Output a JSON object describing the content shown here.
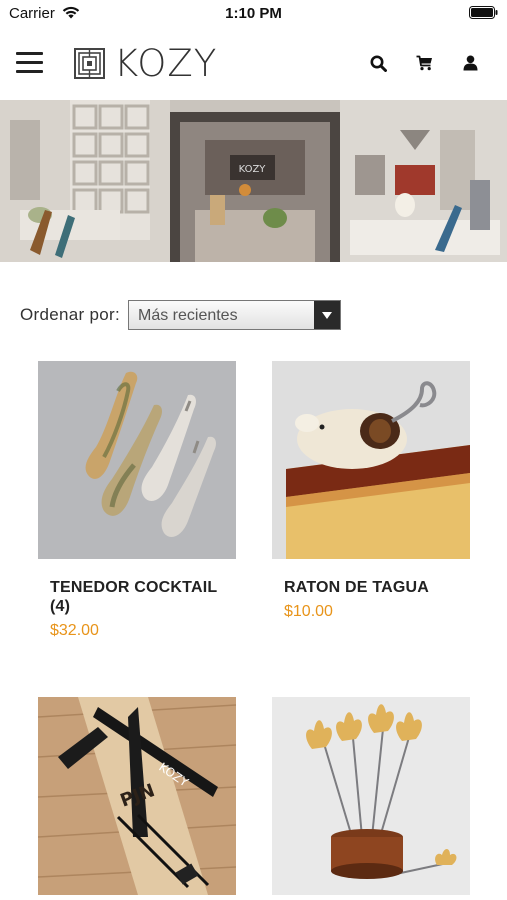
{
  "status_bar": {
    "carrier": "Carrier",
    "time": "1:10 PM"
  },
  "header": {
    "brand": "KOZY"
  },
  "sort": {
    "label": "Ordenar por:",
    "selected": "Más recientes"
  },
  "products": [
    {
      "name": "TENEDOR COCKTAIL (4)",
      "price": "$32.00"
    },
    {
      "name": "RATON DE TAGUA",
      "price": "$10.00"
    },
    {
      "name": "",
      "price": ""
    },
    {
      "name": "",
      "price": ""
    }
  ],
  "colors": {
    "price": "#e8941a",
    "text": "#222222",
    "select_arrow_bg": "#2a2a2a"
  },
  "icons": [
    "wifi-icon",
    "battery-icon",
    "menu-icon",
    "logo-icon",
    "search-icon",
    "cart-icon",
    "user-icon",
    "chevron-down-icon"
  ]
}
